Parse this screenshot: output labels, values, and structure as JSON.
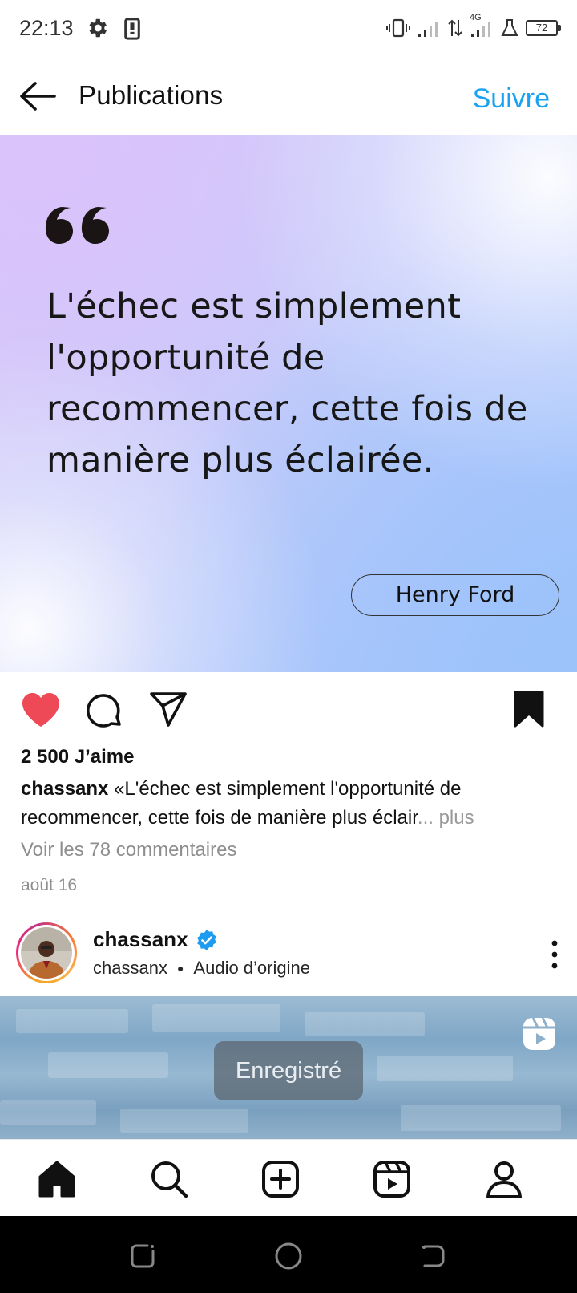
{
  "status_bar": {
    "time": "22:13",
    "network": "4G",
    "battery": "72",
    "icons": [
      "gear-icon",
      "phone-icon",
      "vibrate-icon",
      "signal-icon",
      "data-transfer-icon",
      "signal-4g-icon",
      "beaker-icon",
      "battery-icon"
    ]
  },
  "header": {
    "title": "Publications",
    "follow_label": "Suivre",
    "back_icon": "arrow-left-icon"
  },
  "post": {
    "quote": "L'échec est simplement l'opportunité de recommencer, cette fois de manière plus éclairée.",
    "author": "Henry Ford",
    "liked": true,
    "saved": true,
    "likes": "2 500 J’aime",
    "caption_user": "chassanx",
    "caption_text": " «L'échec est simplement l'opportunité de recommencer, cette fois de manière plus éclair",
    "caption_more": "... plus",
    "view_comments": "Voir les 78 commentaires",
    "date": "août 16"
  },
  "next_post": {
    "username": "chassanx",
    "verified": true,
    "sub_user": "chassanx",
    "audio": "Audio d’origine",
    "toast": "Enregistré"
  },
  "bottom_nav": [
    "home-icon",
    "search-icon",
    "create-icon",
    "reels-icon",
    "profile-icon"
  ],
  "colors": {
    "accent": "#1aa1f2",
    "like": "#ed4956",
    "verified": "#1d9bf0"
  }
}
